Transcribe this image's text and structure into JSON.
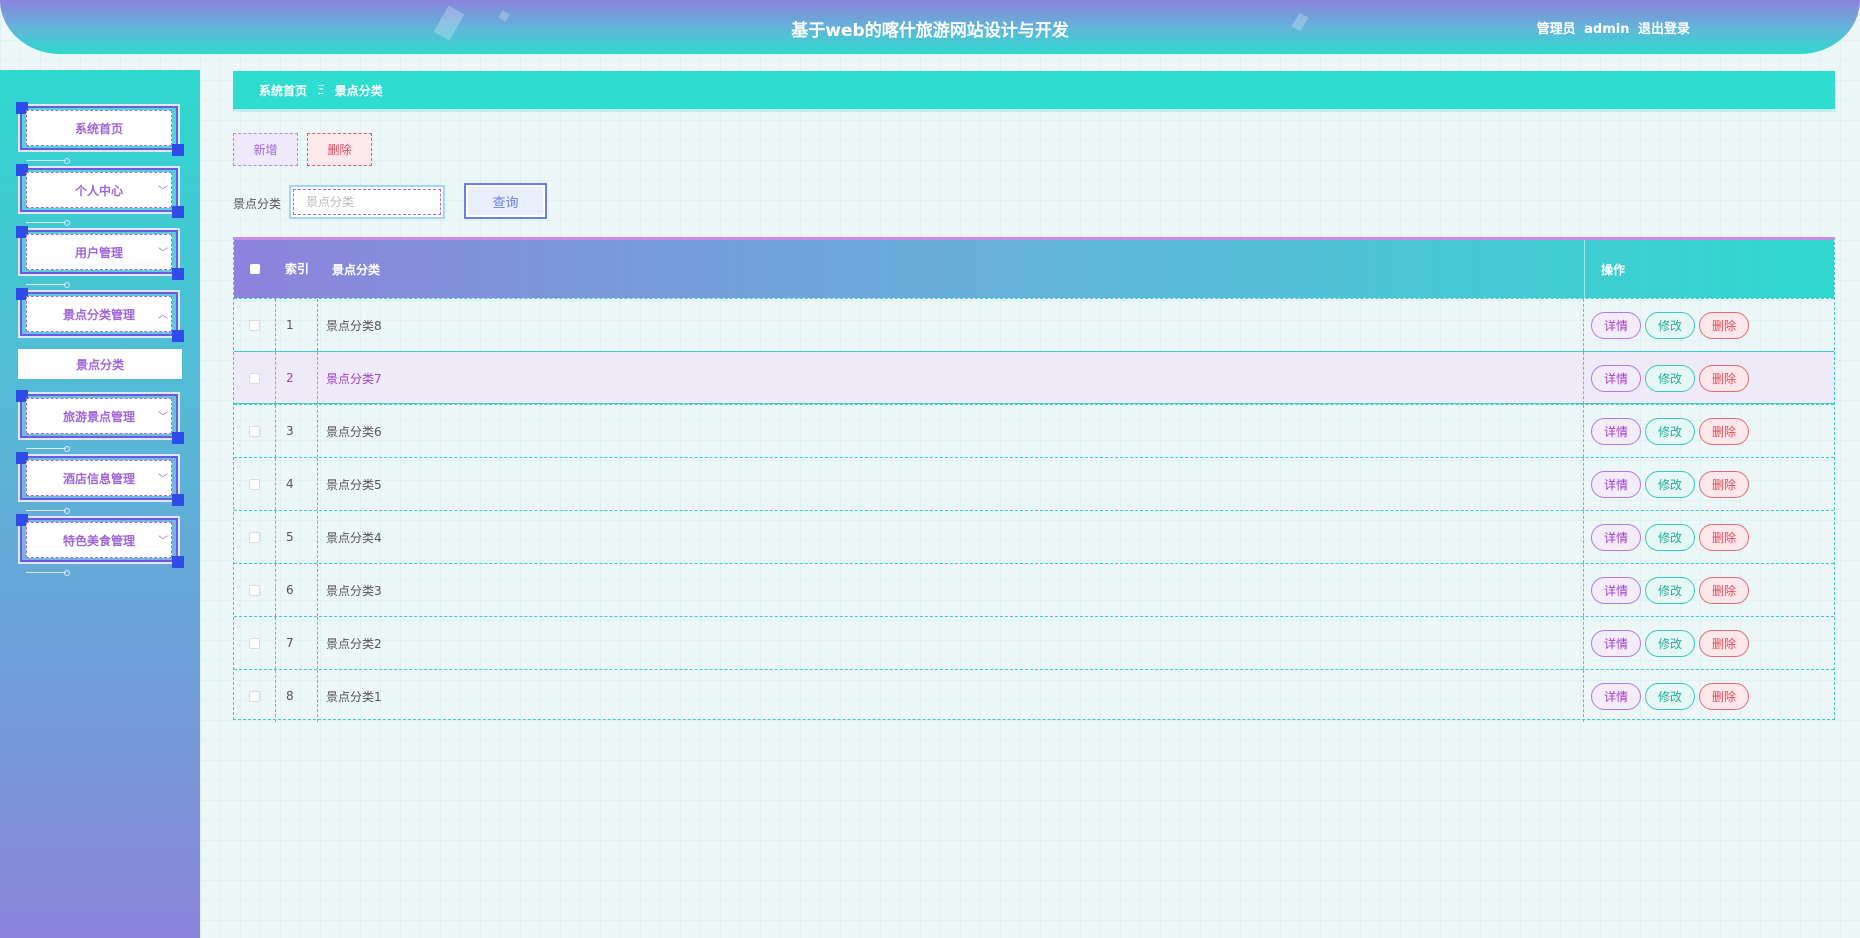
{
  "header": {
    "title": "基于web的喀什旅游网站设计与开发",
    "role": "管理员",
    "username": "admin",
    "logout": "退出登录"
  },
  "sidebar": {
    "items": [
      {
        "label": "系统首页",
        "chevron": ""
      },
      {
        "label": "个人中心",
        "chevron": "﹀"
      },
      {
        "label": "用户管理",
        "chevron": "﹀"
      },
      {
        "label": "景点分类管理",
        "chevron": "︿"
      },
      {
        "label": "旅游景点管理",
        "chevron": "﹀"
      },
      {
        "label": "酒店信息管理",
        "chevron": "﹀"
      },
      {
        "label": "特色美食管理",
        "chevron": "﹀"
      }
    ],
    "submenu_active": "景点分类"
  },
  "breadcrumb": {
    "home": "系统首页",
    "separator": "Ξ",
    "current": "景点分类"
  },
  "toolbar": {
    "add": "新增",
    "delete": "删除"
  },
  "search": {
    "label": "景点分类",
    "placeholder": "景点分类",
    "button": "查询"
  },
  "table": {
    "headers": {
      "index": "索引",
      "name": "景点分类",
      "ops": "操作"
    },
    "ops": {
      "detail": "详情",
      "edit": "修改",
      "delete": "删除"
    },
    "rows": [
      {
        "index": "1",
        "name": "景点分类8"
      },
      {
        "index": "2",
        "name": "景点分类7"
      },
      {
        "index": "3",
        "name": "景点分类6"
      },
      {
        "index": "4",
        "name": "景点分类5"
      },
      {
        "index": "5",
        "name": "景点分类4"
      },
      {
        "index": "6",
        "name": "景点分类3"
      },
      {
        "index": "7",
        "name": "景点分类2"
      },
      {
        "index": "8",
        "name": "景点分类1"
      }
    ]
  },
  "colors": {
    "accent_teal": "#2ed8cf",
    "accent_purple": "#8a84dc",
    "danger": "#e04a5c"
  }
}
